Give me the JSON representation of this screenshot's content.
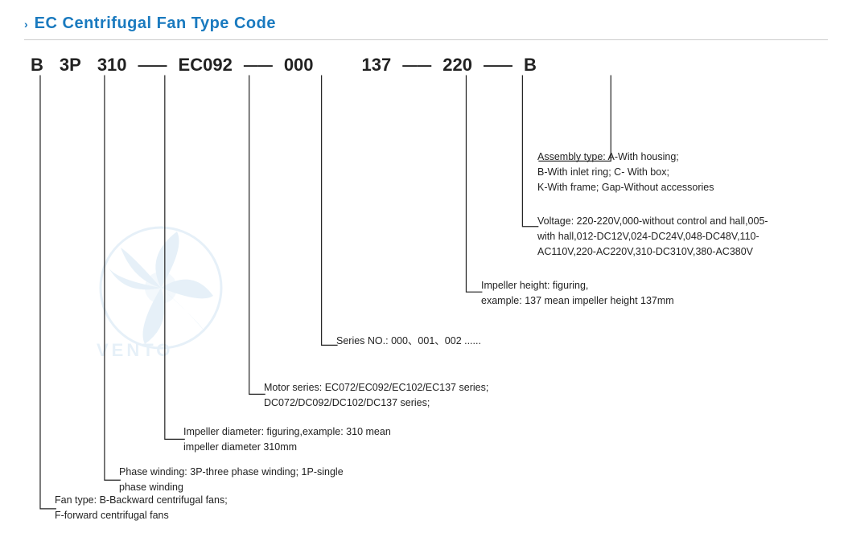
{
  "title": "EC Centrifugal Fan Type Code",
  "chevron": "›",
  "code": {
    "parts": [
      "B",
      "3P",
      "310",
      "EC092",
      "000",
      "137",
      "220",
      "B"
    ],
    "dashes": [
      "—",
      "—",
      "—",
      "—",
      "—",
      "—"
    ]
  },
  "annotations": {
    "assembly": {
      "label": "Assembly type:  A-With housing;",
      "label2": "B-With inlet ring;  C- With box;",
      "label3": "K-With frame; Gap-Without accessories"
    },
    "voltage": {
      "label": "Voltage:  220-220V,000-without control and hall,005-",
      "label2": "with hall,012-DC12V,024-DC24V,048-DC48V,110-",
      "label3": "AC110V,220-AC220V,310-DC310V,380-AC380V"
    },
    "impeller_height": {
      "label": "Impeller height:   figuring,",
      "label2": "example: 137 mean impeller height 137mm"
    },
    "series": {
      "label": "Series NO.:  000、001、002 ......"
    },
    "motor": {
      "label": "Motor series:  EC072/EC092/EC102/EC137 series;",
      "label2": "DC072/DC092/DC102/DC137 series;"
    },
    "impeller_diameter": {
      "label": "Impeller diameter:  figuring,example: 310 mean",
      "label2": "impeller diameter 310mm"
    },
    "phase": {
      "label": "Phase winding:  3P-three phase winding;  1P-single",
      "label2": "phase winding"
    },
    "fan_type": {
      "label": "Fan type:  B-Backward centrifugal fans;",
      "label2": "F-forward centrifugal fans"
    }
  }
}
